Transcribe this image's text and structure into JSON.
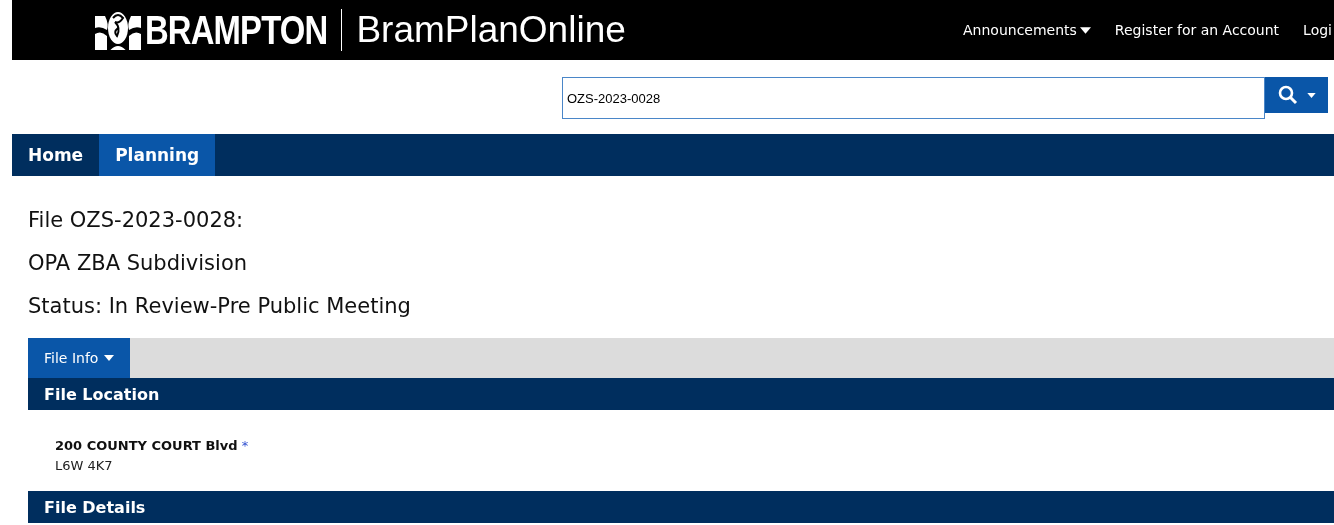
{
  "header": {
    "logo_text": "BRAMPTON",
    "site_title": "BramPlanOnline",
    "links": [
      {
        "label": "Announcements",
        "kind": "dropdown"
      },
      {
        "label": "Register for an Account",
        "kind": "link"
      },
      {
        "label": "Logi",
        "kind": "link"
      }
    ]
  },
  "search": {
    "value": "OZS-2023-0028"
  },
  "nav": [
    {
      "label": "Home",
      "selected": false
    },
    {
      "label": "Planning",
      "selected": true
    }
  ],
  "headings": [
    "File OZS-2023-0028:",
    "OPA ZBA Subdivision",
    "Status: In Review-Pre Public Meeting"
  ],
  "tabs": [
    {
      "label": "File Info",
      "selected": true
    }
  ],
  "sections": [
    {
      "title": "File Location",
      "address": "200 COUNTY COURT Blvd",
      "required_mark": "*",
      "postal": "L6W 4K7"
    },
    {
      "title": "File Details"
    }
  ]
}
